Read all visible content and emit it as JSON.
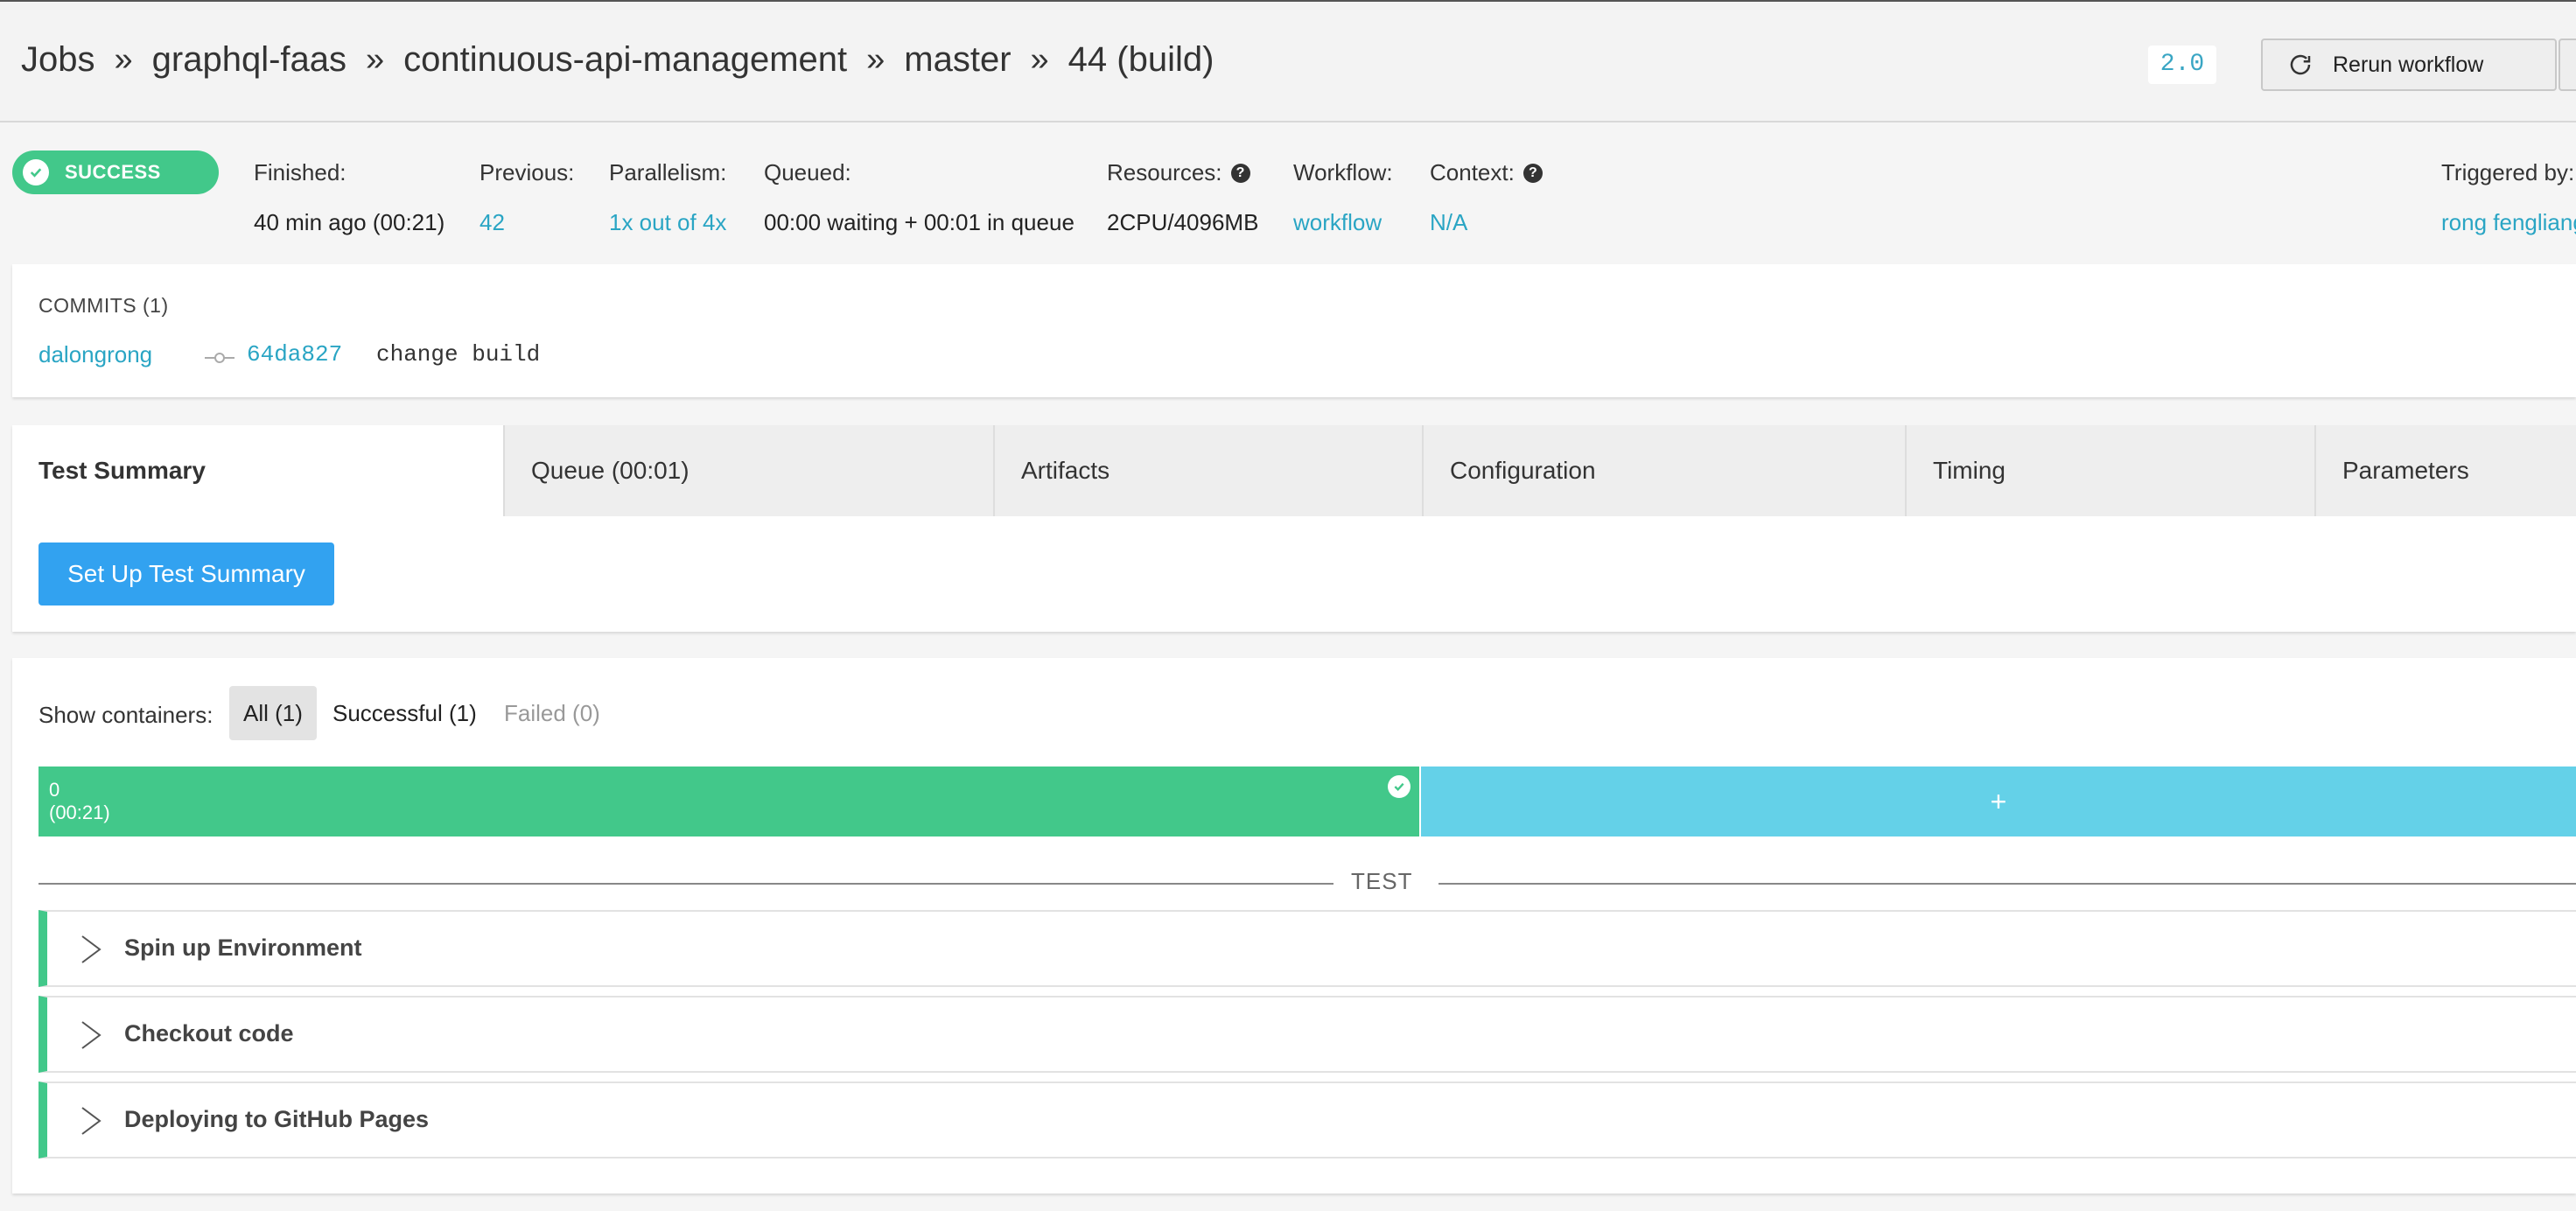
{
  "header": {
    "breadcrumb": [
      "Jobs",
      "graphql-faas",
      "continuous-api-management",
      "master",
      "44 (build)"
    ],
    "separator": "»",
    "version": "2.0",
    "rerun_label": "Rerun workflow"
  },
  "build": {
    "status": "SUCCESS",
    "status_color": "#42c88a",
    "finished_label": "Finished:",
    "finished_value": "40 min ago (00:21)",
    "previous_label": "Previous:",
    "previous_value": "42",
    "parallelism_label": "Parallelism:",
    "parallelism_value": "1x out of 4x",
    "queued_label": "Queued:",
    "queued_value": "00:00 waiting + 00:01 in queue",
    "resources_label": "Resources:",
    "resources_value": "2CPU/4096MB",
    "workflow_label": "Workflow:",
    "workflow_value": "workflow",
    "context_label": "Context:",
    "context_value": "N/A",
    "triggered_label": "Triggered by:",
    "triggered_value": "rong fengliang"
  },
  "commits": {
    "title": "COMMITS (1)",
    "items": [
      {
        "author": "dalongrong",
        "sha": "64da827",
        "message": "change build"
      }
    ]
  },
  "tabs": [
    {
      "label": "Test Summary",
      "active": true
    },
    {
      "label": "Queue (00:01)"
    },
    {
      "label": "Artifacts"
    },
    {
      "label": "Configuration"
    },
    {
      "label": "Timing"
    },
    {
      "label": "Parameters"
    }
  ],
  "test_summary": {
    "setup_label": "Set Up Test Summary"
  },
  "containers": {
    "show_label": "Show containers:",
    "filter_all": "All (1)",
    "filter_success": "Successful (1)",
    "filter_failed": "Failed (0)",
    "container_index": "0",
    "container_time": "(00:21)",
    "add_label": "+",
    "section_label": "TEST",
    "steps": [
      "Spin up Environment",
      "Checkout code",
      "Deploying to GitHub Pages"
    ]
  },
  "colors": {
    "accent_link": "#2aa5c4",
    "success": "#42c88a",
    "primary_button": "#32a2f0",
    "add_container": "#64d1e8"
  }
}
